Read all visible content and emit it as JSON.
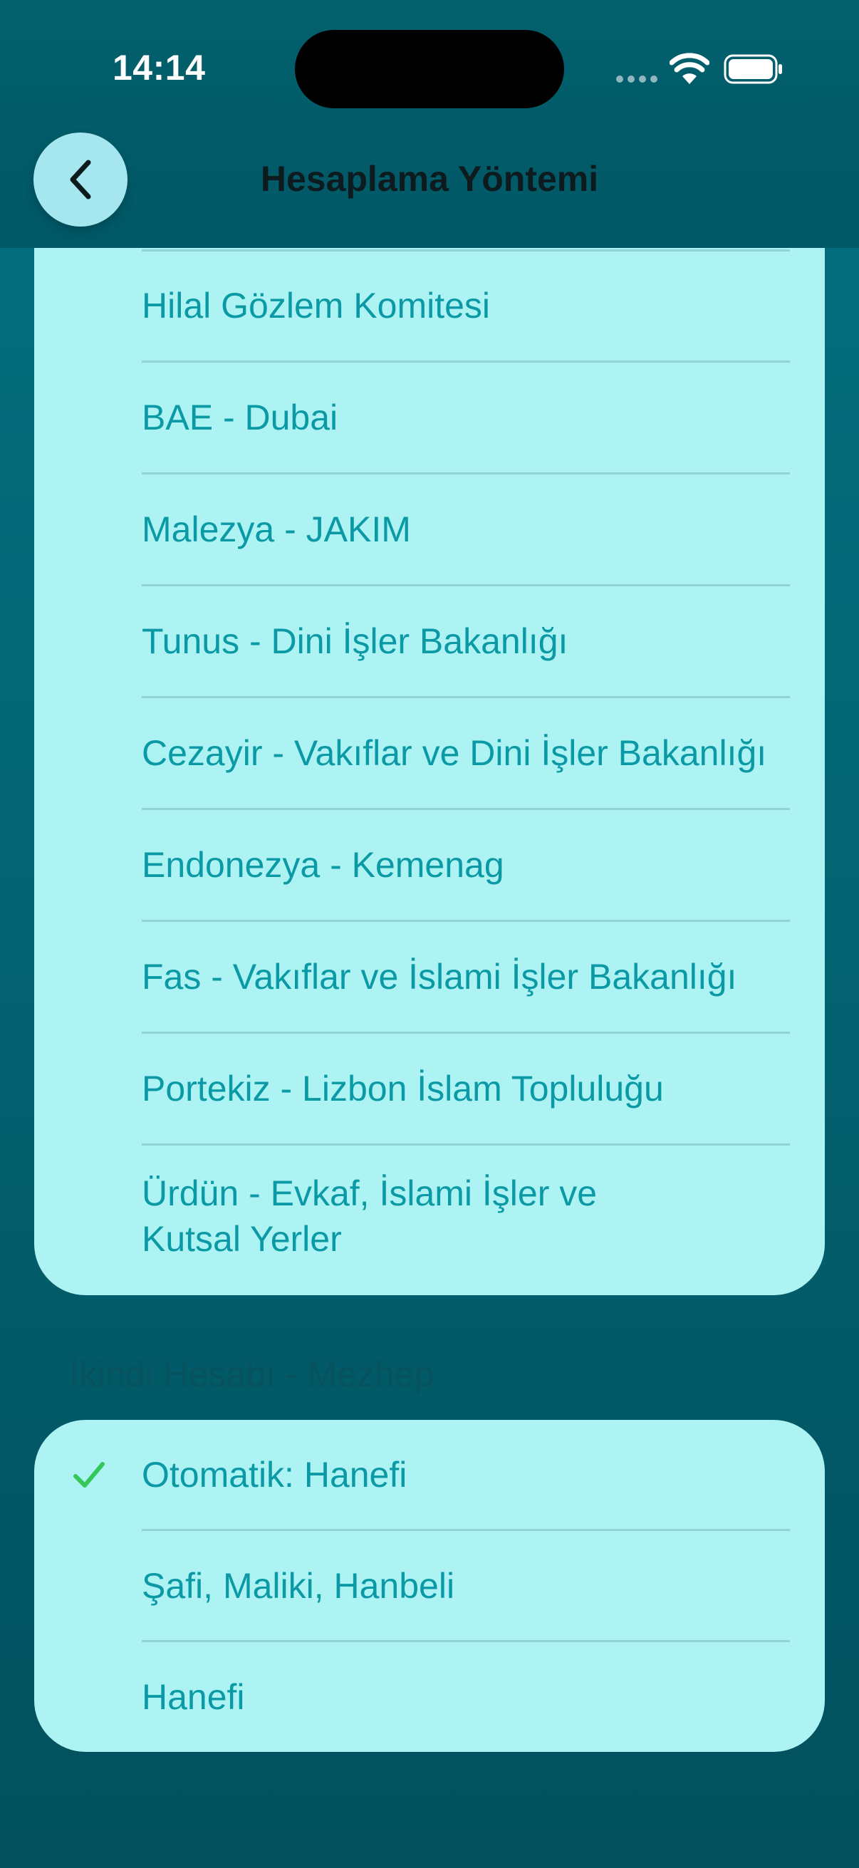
{
  "status_bar": {
    "time": "14:14"
  },
  "nav": {
    "title": "Hesaplama Yöntemi",
    "back_icon": "chevron-left-icon"
  },
  "methods": {
    "items": [
      {
        "label": "Hilal Gözlem Komitesi"
      },
      {
        "label": "BAE - Dubai"
      },
      {
        "label": "Malezya - JAKIM"
      },
      {
        "label": "Tunus - Dini İşler Bakanlığı"
      },
      {
        "label": "Cezayir - Vakıflar ve Dini İşler Bakanlığı"
      },
      {
        "label": "Endonezya - Kemenag"
      },
      {
        "label": "Fas - Vakıflar ve İslami İşler Bakanlığı"
      },
      {
        "label": "Portekiz - Lizbon İslam Topluluğu"
      },
      {
        "label": "Ürdün - Evkaf, İslami İşler ve\nKutsal Yerler"
      }
    ]
  },
  "mezhep": {
    "header": "İkindi Hesabı - Mezhep",
    "items": [
      {
        "label": "Otomatik: Hanefi",
        "selected": true
      },
      {
        "label": "Şafi, Maliki, Hanbeli",
        "selected": false
      },
      {
        "label": "Hanefi",
        "selected": false
      }
    ]
  },
  "colors": {
    "accent_text": "#0b9aa5",
    "card_bg": "#adf3f3",
    "check": "#34c759",
    "background": "#036675"
  }
}
